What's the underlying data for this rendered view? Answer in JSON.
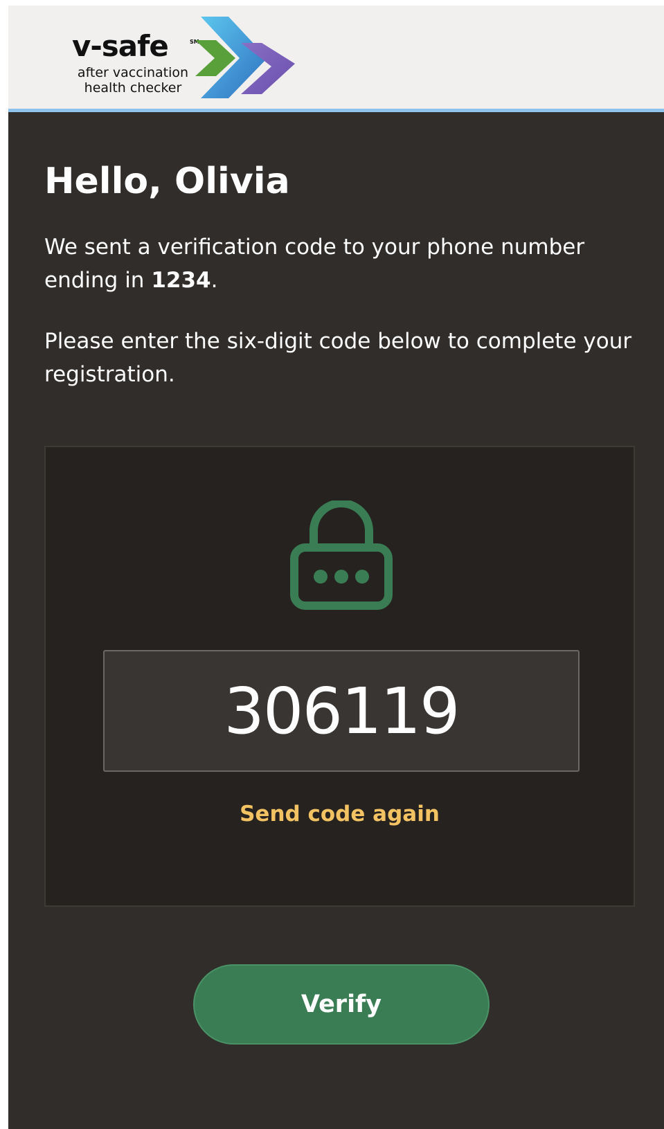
{
  "header": {
    "logo": {
      "wordmark": "v-safe",
      "service_mark": "SM",
      "tagline_line1": "after vaccination",
      "tagline_line2": "health checker",
      "icon": "chevron-arrows-icon"
    }
  },
  "main": {
    "greeting": "Hello, Olivia",
    "message_prefix": "We sent a verification code to your phone number ending in ",
    "phone_last4": "1234",
    "message_suffix": ".",
    "instruction": "Please enter the six-digit code below to complete your registration."
  },
  "verification": {
    "icon": "lock-icon",
    "code_value": "306119",
    "resend_label": "Send code again"
  },
  "actions": {
    "verify_label": "Verify"
  },
  "colors": {
    "background": "#302d2a",
    "card": "#26221f",
    "accent_green": "#3a7d55",
    "link_yellow": "#f3c262",
    "header_rule": "#8fc2ec"
  }
}
